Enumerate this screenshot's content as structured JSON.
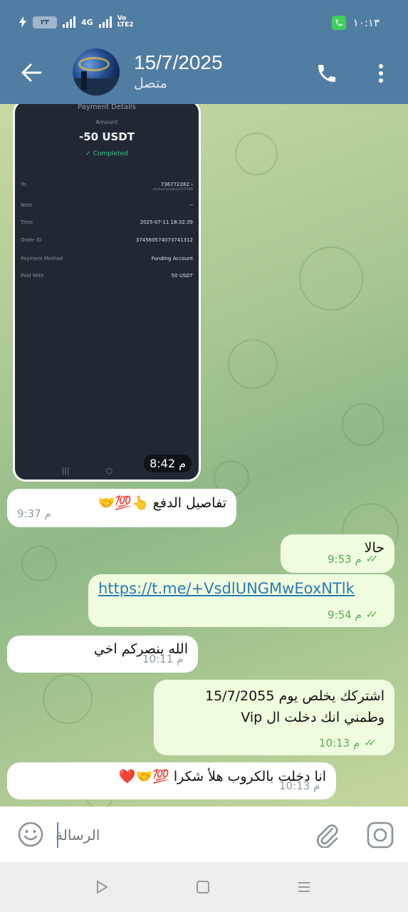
{
  "status_bar": {
    "battery": "٢٣",
    "network": "4G",
    "volte": "Vo LTE2",
    "time": "١٠:١٣"
  },
  "header": {
    "title": "15/7/2025",
    "subtitle": "متصل"
  },
  "screenshot_message": {
    "title": "Payment Details",
    "amount_label": "Amount",
    "amount": "-50 USDT",
    "status": "Completed",
    "rows": [
      {
        "key": "To",
        "value": "736772282",
        "sub": "mohamedaboali10088"
      },
      {
        "key": "Note",
        "value": "--"
      },
      {
        "key": "Time",
        "value": "2025-07-11 18:32:39"
      },
      {
        "key": "Order ID",
        "value": "374560574073741312"
      },
      {
        "key": "Payment Method",
        "value": "Funding Account"
      },
      {
        "key": "Paid With",
        "value": "50 USDT"
      }
    ],
    "time": "8:42 م"
  },
  "messages": [
    {
      "id": "m1",
      "type": "in",
      "text": "تفاصيل الدفع 👆💯🤝",
      "time": "9:37 م"
    },
    {
      "id": "m2",
      "type": "out",
      "text": "حالا",
      "time": "9:53 م"
    },
    {
      "id": "m3",
      "type": "out",
      "text": "https://t.me/+VsdlUNGMwEoxNTlk",
      "time": "9:54 م"
    },
    {
      "id": "m4",
      "type": "in",
      "text": "الله ينصركم اخي",
      "time": "10:11 م"
    },
    {
      "id": "m5",
      "type": "out",
      "line1": "اشتركك يخلص يوم 15/7/2055",
      "line2": "وطمني انك دخلت ال Vip",
      "time": "10:13 م"
    },
    {
      "id": "m6",
      "type": "in",
      "text": "انا دخلت بالكروب هلأ  شكرا 💯🤝❤️",
      "time": "10:13 م"
    }
  ],
  "input": {
    "placeholder": "الرسالة"
  },
  "icons": {
    "back": "arrow-left-icon",
    "call": "phone-icon",
    "menu": "more-vertical-icon",
    "emoji": "smiley-icon",
    "attach": "paperclip-icon",
    "camera": "camera-icon"
  },
  "colors": {
    "header": "#527da3",
    "incoming_bubble": "#ffffff",
    "outgoing_bubble": "#effdde",
    "read_ticks": "#4fae4e",
    "link": "#2b79b7"
  }
}
